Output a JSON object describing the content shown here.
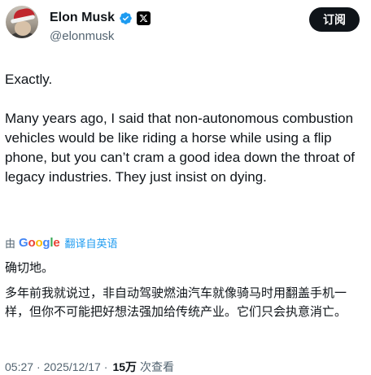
{
  "header": {
    "display_name": "Elon Musk",
    "handle": "@elonmusk",
    "subscribe_label": "订阅"
  },
  "tweet": {
    "paragraphs": [
      "Exactly.",
      "Many years ago, I said that non-autonomous combustion vehicles would be like riding a horse while using a flip phone, but you can’t cram a good idea down the throat of legacy industries. They just insist on dying."
    ]
  },
  "translation_bar": {
    "by_label": "由",
    "provider": "Google",
    "link_label": "翻译自英语"
  },
  "translation": {
    "paragraphs": [
      "确切地。",
      "多年前我就说过，非自动驾驶燃油汽车就像骑马时用翻盖手机一样，但你不可能把好想法强加给传统产业。它们只会执意消亡。"
    ]
  },
  "meta": {
    "time": "05:27",
    "separator": "·",
    "date": "2025/12/17",
    "views_count": "15万",
    "views_label": "次查看"
  },
  "icons": {
    "avatar": "profile-avatar",
    "verified": "verified-badge-icon",
    "platform": "x-logo-icon"
  },
  "colors": {
    "verified_blue": "#1d9bf0",
    "link_blue": "#1d9bf0",
    "text_primary": "#0f1419",
    "text_secondary": "#536471",
    "button_bg": "#0f1419"
  }
}
